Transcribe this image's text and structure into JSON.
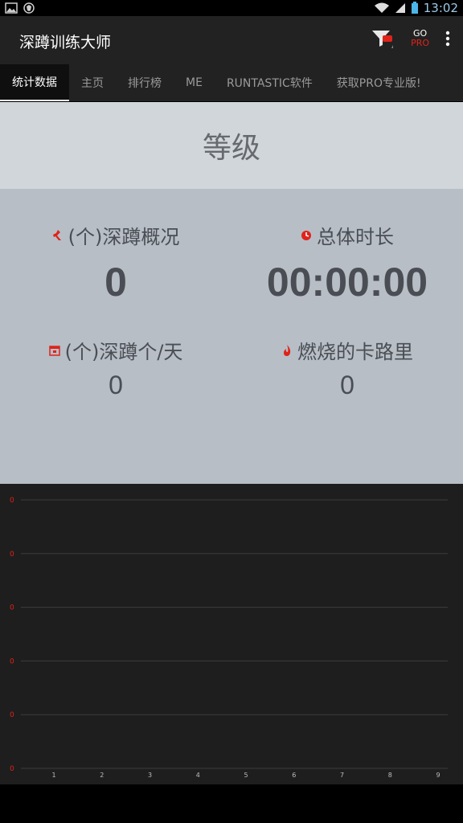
{
  "status_bar": {
    "time": "13:02"
  },
  "app_bar": {
    "title": "深蹲训练大师",
    "go_label": "GO",
    "pro_label": "PRO"
  },
  "tabs": [
    {
      "label": "统计数据",
      "active": true
    },
    {
      "label": "主页"
    },
    {
      "label": "排行榜"
    },
    {
      "label": "ME"
    },
    {
      "label": "RUNTASTIC软件"
    },
    {
      "label": "获取PRO专业版!"
    }
  ],
  "level": {
    "title": "等级"
  },
  "stats": {
    "squats_total": {
      "label": "(个)深蹲概况",
      "value": "0",
      "icon": "squat-icon"
    },
    "total_time": {
      "label": "总体时长",
      "value": "00:00:00",
      "icon": "clock-icon"
    },
    "squats_per_day": {
      "label": "(个)深蹲个/天",
      "value": "0",
      "icon": "calendar-icon"
    },
    "calories": {
      "label": "燃烧的卡路里",
      "value": "0",
      "icon": "flame-icon"
    }
  },
  "colors": {
    "accent": "#e0221a",
    "stats_bg": "#b7bec6",
    "level_bg": "#d1d6da"
  },
  "chart_data": {
    "type": "line",
    "x": [
      1,
      2,
      3,
      4,
      5,
      6,
      7,
      8,
      9
    ],
    "y_tick_labels": [
      "0",
      "0",
      "0",
      "0",
      "0",
      "0"
    ],
    "series": [],
    "grid": true
  }
}
